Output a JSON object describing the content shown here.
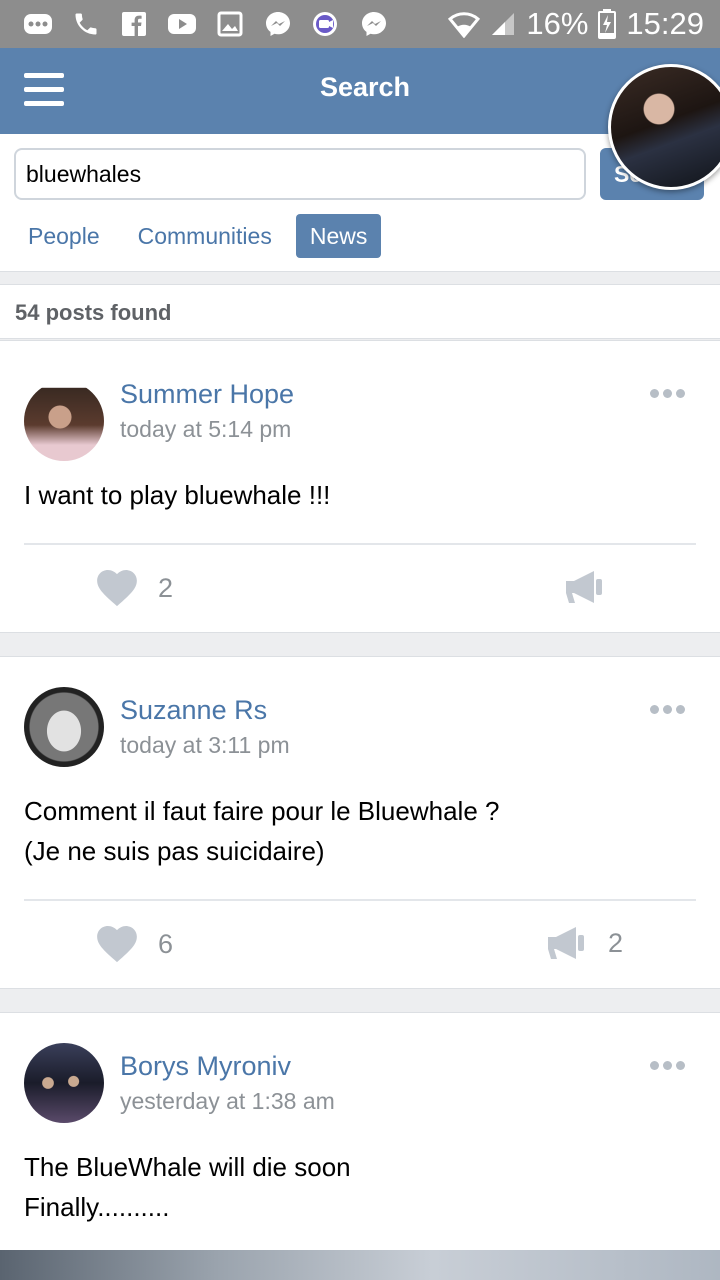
{
  "status_bar": {
    "battery": "16%",
    "time": "15:29",
    "notification_icons": [
      "more-icon",
      "phone-icon",
      "facebook-icon",
      "youtube-icon",
      "gallery-icon",
      "messenger-icon",
      "video-call-icon",
      "messenger-icon"
    ]
  },
  "header": {
    "title": "Search"
  },
  "search": {
    "value": "bluewhales",
    "button_label": "Search"
  },
  "tabs": [
    {
      "label": "People",
      "active": false
    },
    {
      "label": "Communities",
      "active": false
    },
    {
      "label": "News",
      "active": true
    }
  ],
  "results": {
    "count_text": "54 posts found"
  },
  "posts": [
    {
      "author": "Summer Hope",
      "time": "today at 5:14 pm",
      "text": "I want to play bluewhale !!!",
      "likes": "2",
      "shares": ""
    },
    {
      "author": "Suzanne Rs",
      "time": "today at 3:11 pm",
      "text": "Comment il faut faire pour le Bluewhale ?\n(Je ne suis pas suicidaire)",
      "likes": "6",
      "shares": "2"
    },
    {
      "author": "Borys Myroniv",
      "time": "yesterday at 1:38 am",
      "text": "The BlueWhale will die soon\nFinally..........",
      "likes": "",
      "shares": ""
    }
  ],
  "colors": {
    "brand": "#5b82ae",
    "link": "#4a76a8",
    "muted": "#8c9196",
    "icon": "#c2c8d0"
  }
}
